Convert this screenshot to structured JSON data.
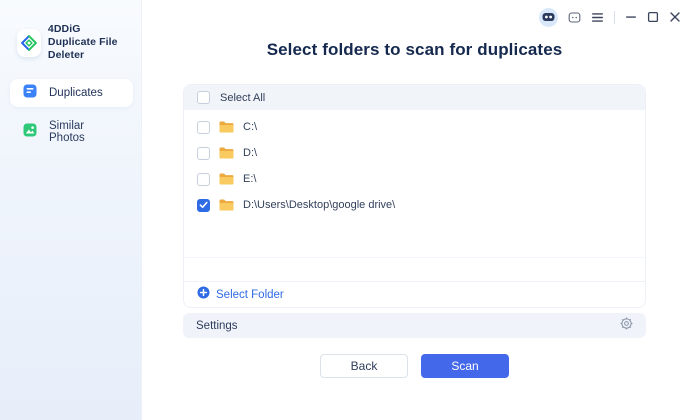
{
  "app": {
    "name": "4DDiG",
    "subtitle": "Duplicate File Deleter"
  },
  "sidebar": {
    "items": [
      {
        "label": "Duplicates",
        "active": true,
        "icon": "document-icon"
      },
      {
        "label": "Similar Photos",
        "active": false,
        "icon": "photo-icon"
      }
    ]
  },
  "titlebar": {
    "icons": [
      "bot-assistant",
      "feedback",
      "menu",
      "minimize",
      "maximize",
      "close"
    ]
  },
  "main": {
    "title": "Select folders to scan for duplicates",
    "select_all_label": "Select All",
    "select_all_checked": false,
    "folders": [
      {
        "path": "C:\\",
        "checked": false
      },
      {
        "path": "D:\\",
        "checked": false
      },
      {
        "path": "E:\\",
        "checked": false
      },
      {
        "path": "D:\\Users\\Desktop\\google drive\\",
        "checked": true
      }
    ],
    "select_folder_label": "Select Folder",
    "settings_label": "Settings",
    "back_label": "Back",
    "scan_label": "Scan"
  },
  "colors": {
    "accent_blue": "#4468EA",
    "link_blue": "#2F6BE4",
    "checkbox_checked": "#2F6BE4",
    "folder_yellow": "#F6C14F",
    "sidebar_top": "#F8FBFE",
    "sidebar_bottom": "#E7EEF9",
    "panel_header_bg": "#F1F5FA",
    "settings_bg": "#F0F4FA",
    "title_text": "#15294E",
    "row_text": "#33415C",
    "green_icon": "#2EC878",
    "blue_icon": "#3B82F6"
  }
}
